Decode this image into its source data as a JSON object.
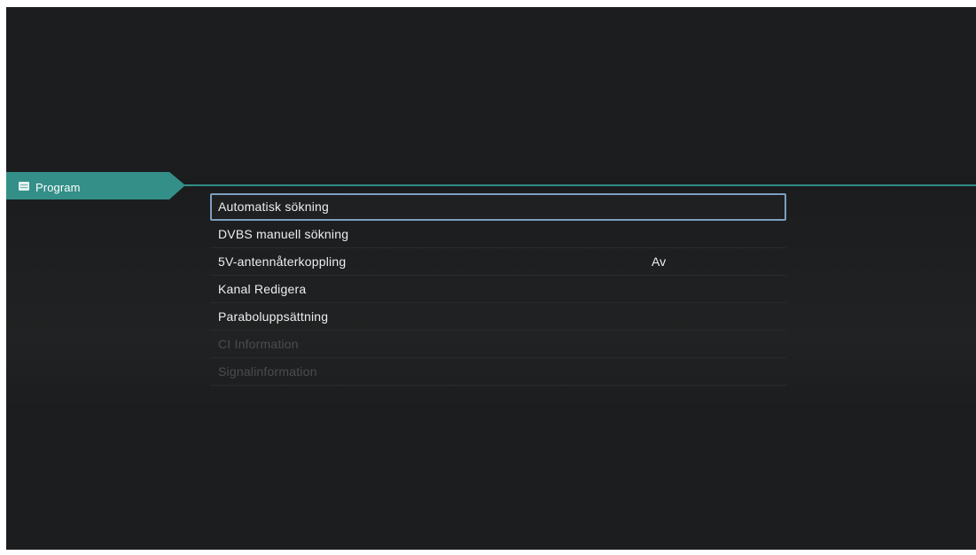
{
  "sidebar": {
    "tab": {
      "label": "Program",
      "icon": "menu-list-icon"
    }
  },
  "menu": {
    "items": [
      {
        "label": "Automatisk sökning",
        "value": "",
        "selected": true,
        "enabled": true
      },
      {
        "label": "DVBS manuell sökning",
        "value": "",
        "selected": false,
        "enabled": true
      },
      {
        "label": "5V-antennåterkoppling",
        "value": "Av",
        "selected": false,
        "enabled": true
      },
      {
        "label": "Kanal Redigera",
        "value": "",
        "selected": false,
        "enabled": true
      },
      {
        "label": "Paraboluppsättning",
        "value": "",
        "selected": false,
        "enabled": true
      },
      {
        "label": "CI Information",
        "value": "",
        "selected": false,
        "enabled": false
      },
      {
        "label": "Signalinformation",
        "value": "",
        "selected": false,
        "enabled": false
      }
    ]
  },
  "colors": {
    "background": "#1c1d1f",
    "accent": "#338f88",
    "focus_border": "#7c9fbe",
    "text": "#eeeeee",
    "disabled_text": "#4a4c4f"
  }
}
